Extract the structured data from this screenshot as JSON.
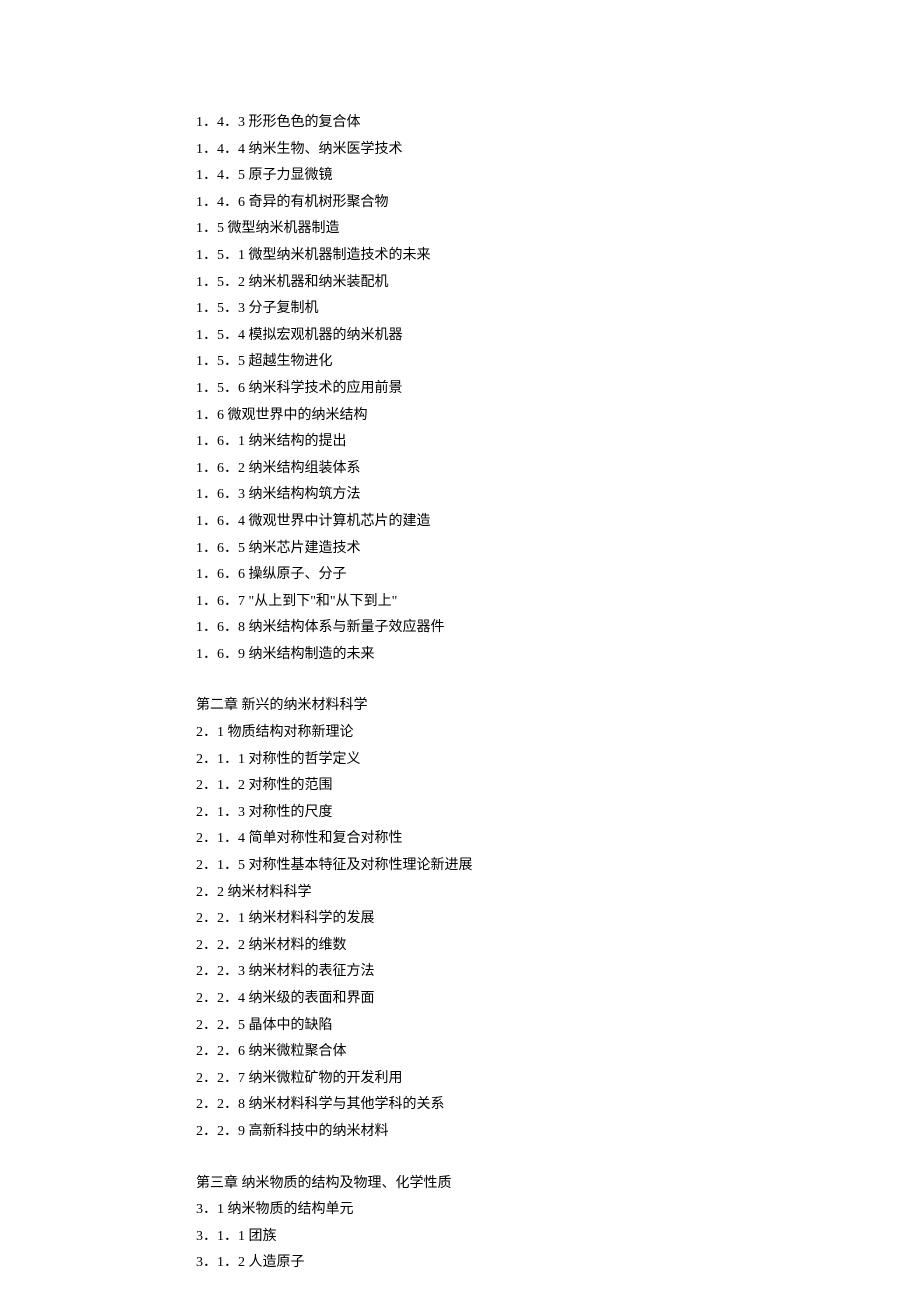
{
  "lines": [
    "1．4．3 形形色色的复合体",
    "1．4．4 纳米生物、纳米医学技术",
    "1．4．5 原子力显微镜",
    "1．4．6 奇异的有机树形聚合物",
    "1．5 微型纳米机器制造",
    "1．5．1 微型纳米机器制造技术的未来",
    "1．5．2 纳米机器和纳米装配机",
    "1．5．3 分子复制机",
    "1．5．4 模拟宏观机器的纳米机器",
    "1．5．5 超越生物进化",
    "1．5．6 纳米科学技术的应用前景",
    "1．6 微观世界中的纳米结构",
    "1．6．1 纳米结构的提出",
    "1．6．2 纳米结构组装体系",
    "1．6．3 纳米结构构筑方法",
    "1．6．4 微观世界中计算机芯片的建造",
    "1．6．5 纳米芯片建造技术",
    "1．6．6 操纵原子、分子",
    "1．6．7 \"从上到下\"和\"从下到上\"",
    "1．6．8 纳米结构体系与新量子效应器件",
    "1．6．9 纳米结构制造的未来",
    "",
    "第二章 新兴的纳米材料科学",
    "2．1 物质结构对称新理论",
    "2．1．1 对称性的哲学定义",
    "2．1．2 对称性的范围",
    "2．1．3 对称性的尺度",
    "2．1．4 简单对称性和复合对称性",
    "2．1．5 对称性基本特征及对称性理论新进展",
    "2．2 纳米材料科学",
    "2．2．1 纳米材料科学的发展",
    "2．2．2 纳米材料的维数",
    "2．2．3 纳米材料的表征方法",
    "2．2．4 纳米级的表面和界面",
    "2．2．5 晶体中的缺陷",
    "2．2．6 纳米微粒聚合体",
    "2．2．7 纳米微粒矿物的开发利用",
    "2．2．8 纳米材料科学与其他学科的关系",
    "2．2．9 高新科技中的纳米材料",
    "",
    "第三章 纳米物质的结构及物理、化学性质",
    "3．1 纳米物质的结构单元",
    "3．1．1 团族",
    "3．1．2 人造原子"
  ]
}
